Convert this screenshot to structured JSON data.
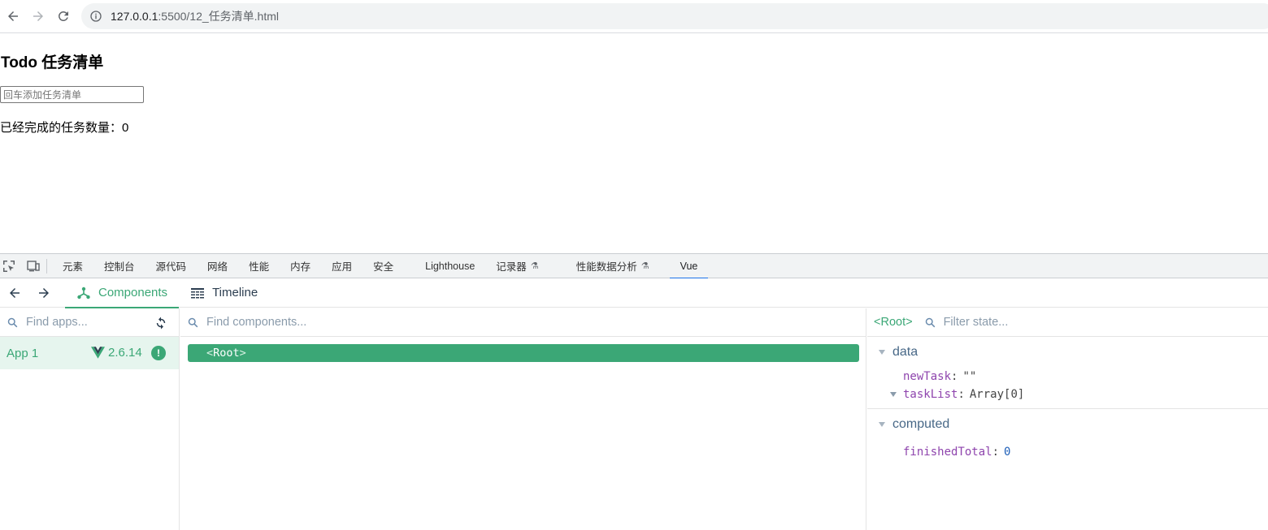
{
  "browser": {
    "url_host": "127.0.0.1",
    "url_path": ":5500/12_任务清单.html"
  },
  "page": {
    "title": "Todo 任务清单",
    "input_placeholder": "回车添加任务清单",
    "finished_label": "已经完成的任务数量：",
    "finished_value": "0"
  },
  "devtools": {
    "tabs": [
      "元素",
      "控制台",
      "源代码",
      "网络",
      "性能",
      "内存",
      "应用",
      "安全",
      "Lighthouse",
      "记录器",
      "性能数据分析",
      "Vue"
    ],
    "active_tab": "Vue"
  },
  "vue": {
    "tabs": {
      "components": "Components",
      "timeline": "Timeline"
    },
    "apps_search_placeholder": "Find apps...",
    "components_search_placeholder": "Find components...",
    "state_filter_placeholder": "Filter state...",
    "app": {
      "name": "App 1",
      "version": "2.6.14",
      "warn": "!"
    },
    "root_component": "Root",
    "selected_component_label": "Root",
    "state": {
      "data_title": "data",
      "data": [
        {
          "key": "newTask",
          "value": "\"\""
        },
        {
          "key": "taskList",
          "value": "Array[0]"
        }
      ],
      "computed_title": "computed",
      "computed": [
        {
          "key": "finishedTotal",
          "value": "0"
        }
      ]
    }
  },
  "colors": {
    "vue_green": "#3ba776",
    "devtools_active": "#1a73e8"
  }
}
